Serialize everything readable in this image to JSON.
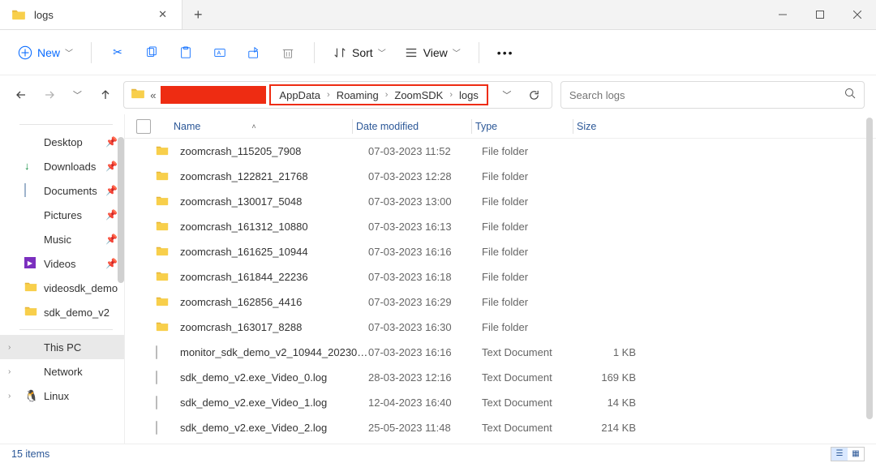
{
  "tab": {
    "title": "logs"
  },
  "toolbar": {
    "new": "New",
    "sort": "Sort",
    "view": "View"
  },
  "breadcrumb": [
    "AppData",
    "Roaming",
    "ZoomSDK",
    "logs"
  ],
  "search": {
    "placeholder": "Search logs"
  },
  "sidebar": {
    "pinned": [
      {
        "label": "Desktop",
        "icon": "desktop"
      },
      {
        "label": "Downloads",
        "icon": "downloads"
      },
      {
        "label": "Documents",
        "icon": "documents"
      },
      {
        "label": "Pictures",
        "icon": "pictures"
      },
      {
        "label": "Music",
        "icon": "music"
      },
      {
        "label": "Videos",
        "icon": "videos"
      },
      {
        "label": "videosdk_demo",
        "icon": "folder"
      },
      {
        "label": "sdk_demo_v2",
        "icon": "folder"
      }
    ],
    "locations": [
      {
        "label": "This PC",
        "icon": "pc",
        "selected": true
      },
      {
        "label": "Network",
        "icon": "network"
      },
      {
        "label": "Linux",
        "icon": "linux"
      }
    ]
  },
  "columns": {
    "name": "Name",
    "date": "Date modified",
    "type": "Type",
    "size": "Size"
  },
  "files": [
    {
      "name": "zoomcrash_115205_7908",
      "date": "07-03-2023 11:52",
      "type": "File folder",
      "size": "",
      "kind": "folder"
    },
    {
      "name": "zoomcrash_122821_21768",
      "date": "07-03-2023 12:28",
      "type": "File folder",
      "size": "",
      "kind": "folder"
    },
    {
      "name": "zoomcrash_130017_5048",
      "date": "07-03-2023 13:00",
      "type": "File folder",
      "size": "",
      "kind": "folder"
    },
    {
      "name": "zoomcrash_161312_10880",
      "date": "07-03-2023 16:13",
      "type": "File folder",
      "size": "",
      "kind": "folder"
    },
    {
      "name": "zoomcrash_161625_10944",
      "date": "07-03-2023 16:16",
      "type": "File folder",
      "size": "",
      "kind": "folder"
    },
    {
      "name": "zoomcrash_161844_22236",
      "date": "07-03-2023 16:18",
      "type": "File folder",
      "size": "",
      "kind": "folder"
    },
    {
      "name": "zoomcrash_162856_4416",
      "date": "07-03-2023 16:29",
      "type": "File folder",
      "size": "",
      "kind": "folder"
    },
    {
      "name": "zoomcrash_163017_8288",
      "date": "07-03-2023 16:30",
      "type": "File folder",
      "size": "",
      "kind": "folder"
    },
    {
      "name": "monitor_sdk_demo_v2_10944_202303...",
      "date": "07-03-2023 16:16",
      "type": "Text Document",
      "size": "1 KB",
      "kind": "doc"
    },
    {
      "name": "sdk_demo_v2.exe_Video_0.log",
      "date": "28-03-2023 12:16",
      "type": "Text Document",
      "size": "169 KB",
      "kind": "doc"
    },
    {
      "name": "sdk_demo_v2.exe_Video_1.log",
      "date": "12-04-2023 16:40",
      "type": "Text Document",
      "size": "14 KB",
      "kind": "doc"
    },
    {
      "name": "sdk_demo_v2.exe_Video_2.log",
      "date": "25-05-2023 11:48",
      "type": "Text Document",
      "size": "214 KB",
      "kind": "doc"
    }
  ],
  "status": {
    "items": "15 items"
  }
}
